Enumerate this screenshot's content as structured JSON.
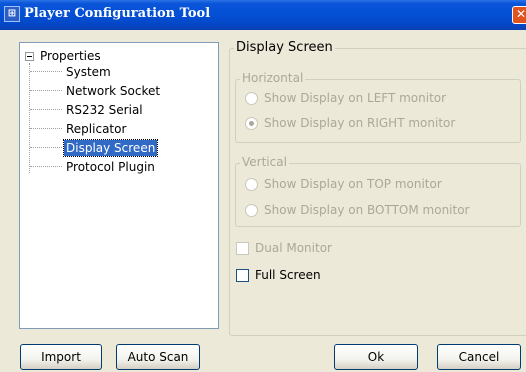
{
  "window": {
    "title": "Player Configuration Tool",
    "icon_glyph": "⊞",
    "close_glyph": "✕"
  },
  "tree": {
    "root_label": "Properties",
    "items": [
      {
        "label": "System"
      },
      {
        "label": "Network Socket"
      },
      {
        "label": "RS232 Serial"
      },
      {
        "label": "Replicator"
      },
      {
        "label": "Display Screen",
        "selected": true
      },
      {
        "label": "Protocol Plugin"
      }
    ]
  },
  "panel": {
    "title": "Display Screen",
    "horizontal": {
      "legend": "Horizontal",
      "options": [
        {
          "label": "Show Display on LEFT monitor",
          "checked": false
        },
        {
          "label": "Show Display on RIGHT monitor",
          "checked": true
        }
      ]
    },
    "vertical": {
      "legend": "Vertical",
      "options": [
        {
          "label": "Show Display on TOP monitor",
          "checked": false
        },
        {
          "label": "Show Display on BOTTOM monitor",
          "checked": false
        }
      ]
    },
    "dual_monitor_label": "Dual Monitor",
    "full_screen_label": "Full Screen"
  },
  "buttons": {
    "import": "Import",
    "auto_scan": "Auto Scan",
    "ok": "Ok",
    "cancel": "Cancel"
  },
  "colors": {
    "titlebar": "#0450d6",
    "selection": "#316ac5",
    "dialog_bg": "#ece9d8"
  }
}
